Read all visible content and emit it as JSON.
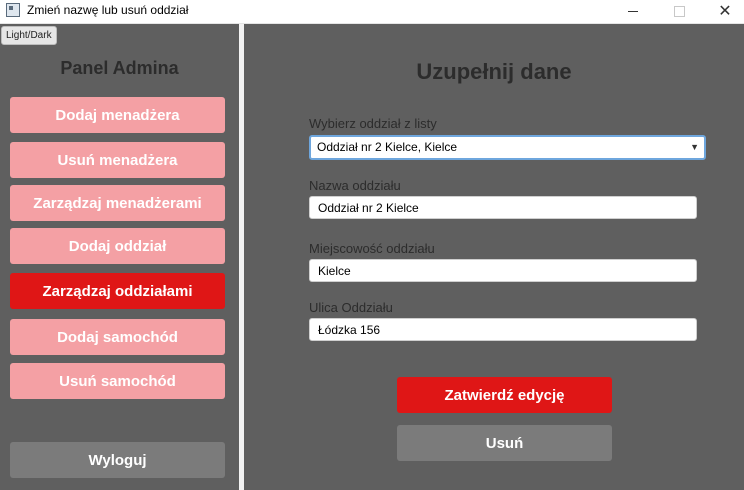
{
  "window": {
    "title": "Zmień nazwę lub usuń oddział",
    "controls": [
      "minimize-icon",
      "maximize-icon",
      "close-icon"
    ],
    "close_glyph": "✕"
  },
  "sidebar": {
    "theme_toggle": "Light/Dark",
    "title": "Panel Admina",
    "items": [
      {
        "label": "Dodaj menadżera",
        "active": false
      },
      {
        "label": "Usuń menadżera",
        "active": false
      },
      {
        "label": "Zarządzaj menadżerami",
        "active": false
      },
      {
        "label": "Dodaj oddział",
        "active": false
      },
      {
        "label": "Zarządzaj oddziałami",
        "active": true
      },
      {
        "label": "Dodaj samochód",
        "active": false
      },
      {
        "label": "Usuń samochód",
        "active": false
      }
    ],
    "logout_label": "Wyloguj"
  },
  "form": {
    "title": "Uzupełnij dane",
    "branch_select": {
      "label": "Wybierz oddział z listy",
      "value": "Oddział nr 2 Kielce, Kielce"
    },
    "branch_name": {
      "label": "Nazwa oddziału",
      "value": "Oddział nr 2 Kielce"
    },
    "branch_city": {
      "label": "Miejscowość oddziału",
      "value": "Kielce"
    },
    "branch_street": {
      "label": "Ulica Oddziału",
      "value": "Łódzka 156"
    },
    "confirm_label": "Zatwierdź edycję",
    "delete_label": "Usuń"
  },
  "colors": {
    "accent_active": "#df1616",
    "nav_inactive": "#f4a0a4",
    "secondary_button": "#7b7b7b",
    "background": "#5f5f5f"
  }
}
